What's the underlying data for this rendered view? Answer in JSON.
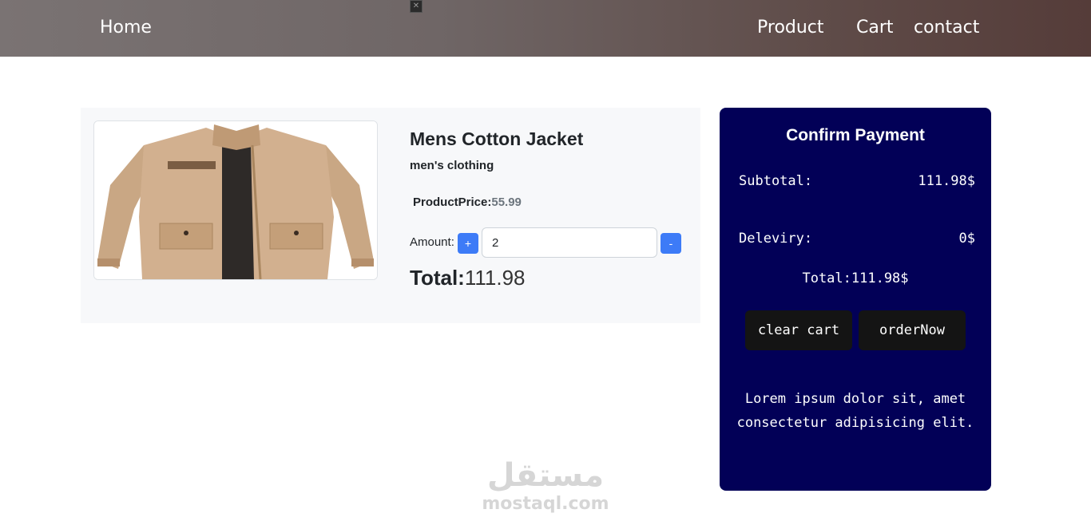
{
  "nav": {
    "home": "Home",
    "product": "Product",
    "cart": "Cart",
    "contact": "contact"
  },
  "product": {
    "title": "Mens Cotton Jacket",
    "category": "men's clothing",
    "price_label": "ProductPrice:",
    "price_value": "55.99",
    "amount_label": "Amount:",
    "plus_label": "+",
    "minus_label": "-",
    "quantity": "2",
    "total_label": "Total:",
    "total_value": "111.98",
    "image_icon": "jacket-image"
  },
  "payment": {
    "title": "Confirm Payment",
    "subtotal_label": "Subtotal:",
    "subtotal_value": "111.98$",
    "delivery_label": "Deleviry:",
    "delivery_value": "0$",
    "total": "Total:111.98$",
    "clear_label": "clear cart",
    "order_label": "orderNow",
    "note": "Lorem ipsum dolor sit, amet consectetur adipisicing elit.",
    "background_color": "#020057"
  },
  "watermark": {
    "arabic": "مستقل",
    "latin": "mostaql.com"
  }
}
